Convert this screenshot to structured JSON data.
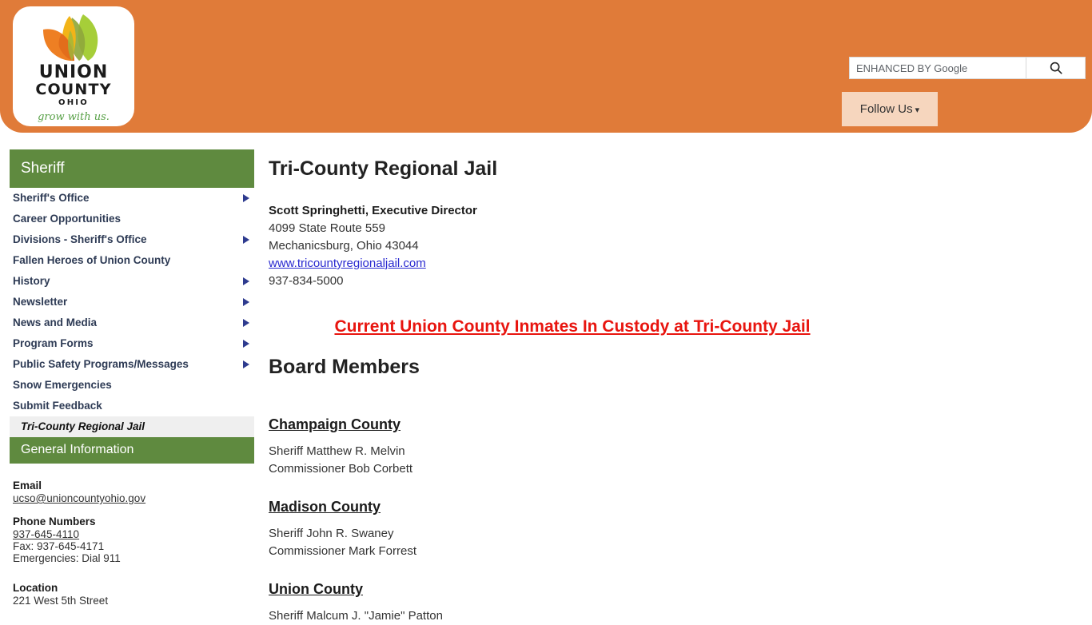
{
  "header": {
    "logo": {
      "line1": "UNION",
      "line2": "COUNTY",
      "line3": "OHIO",
      "tagline": "grow with us.",
      "colors": {
        "orange_leaf": "#EE7F23",
        "yellow_leaf": "#F2B418",
        "green_leaf": "#A6CE39",
        "olive_leaf": "#8FA83C"
      }
    },
    "background_color": "#E07B39",
    "search": {
      "placeholder": "ENHANCED BY Google",
      "value": "",
      "button_icon": "search-icon"
    },
    "follow": {
      "label": "Follow Us",
      "caret": "▾",
      "background_color": "#F6D6BE"
    }
  },
  "sidebar": {
    "title": "Sheriff",
    "title_color": "#5F8A3F",
    "items": [
      {
        "label": "Sheriff's Office",
        "has_submenu": true
      },
      {
        "label": "Career Opportunities",
        "has_submenu": false
      },
      {
        "label": "Divisions - Sheriff's Office",
        "has_submenu": true
      },
      {
        "label": "Fallen Heroes of Union County",
        "has_submenu": false
      },
      {
        "label": "History",
        "has_submenu": true
      },
      {
        "label": "Newsletter",
        "has_submenu": true
      },
      {
        "label": "News and Media",
        "has_submenu": true
      },
      {
        "label": "Program Forms",
        "has_submenu": true
      },
      {
        "label": "Public Safety Programs/Messages",
        "has_submenu": true
      },
      {
        "label": "Snow Emergencies",
        "has_submenu": false
      },
      {
        "label": "Submit Feedback",
        "has_submenu": false
      }
    ],
    "current_item": "Tri-County Regional Jail",
    "active_subitem": "General Information",
    "contact": {
      "email_label": "Email",
      "email_value": "ucso@unioncountyohio.gov",
      "phone_label": "Phone Numbers",
      "phone_value": "937-645-4110",
      "fax_value": "Fax: 937-645-4171",
      "emergency_value": "Emergencies: Dial 911",
      "location_label": "Location",
      "location_value": "221 West 5th Street"
    }
  },
  "main": {
    "page_title": "Tri-County Regional Jail",
    "director": "Scott Springhetti, Executive Director",
    "address_line1": "4099 State Route 559",
    "address_line2": "Mechanicsburg, Ohio 43044",
    "website": "www.tricountyregionaljail.com ",
    "phone": "937-834-5000",
    "inmates_link": "Current Union County Inmates In Custody at Tri-County Jail ",
    "inmates_link_color": "#E8150F",
    "board_title": "Board Members",
    "counties": [
      {
        "name": "Champaign County ",
        "members": [
          "Sheriff Matthew R. Melvin",
          "Commissioner Bob Corbett"
        ]
      },
      {
        "name": "Madison County ",
        "members": [
          "Sheriff John R. Swaney",
          "Commissioner Mark Forrest"
        ]
      },
      {
        "name": "Union County ",
        "members": [
          "Sheriff Malcum J. \"Jamie\" Patton"
        ]
      }
    ]
  }
}
